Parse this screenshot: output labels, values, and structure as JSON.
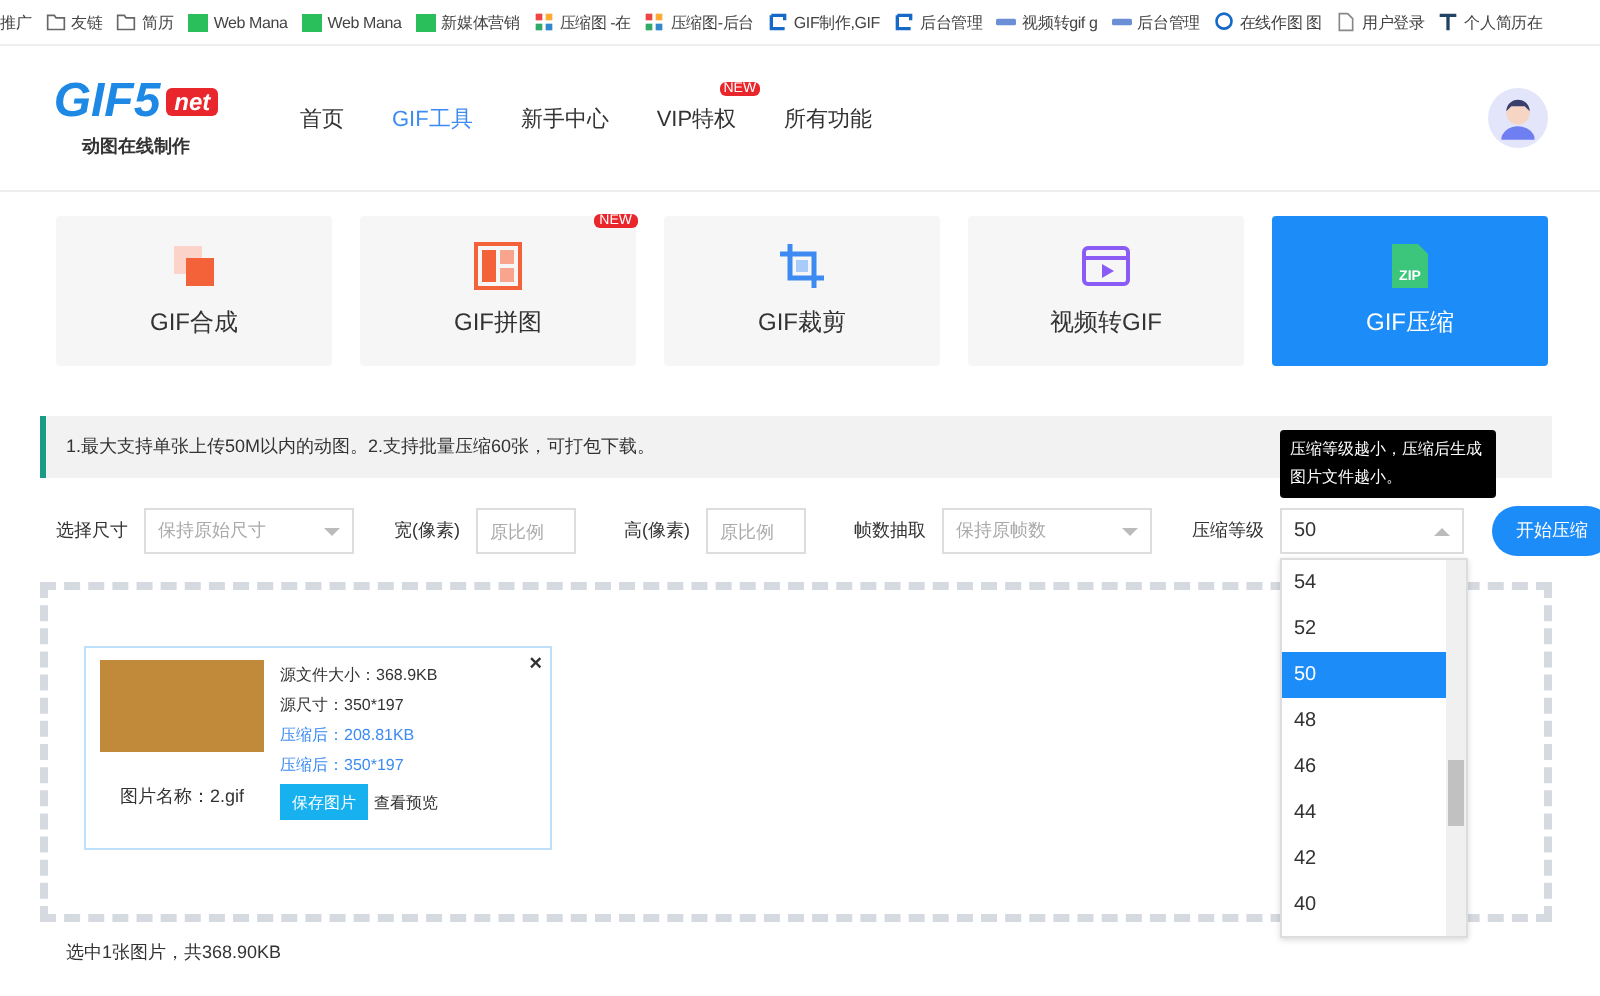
{
  "bookmarks": [
    {
      "label": "推广",
      "kind": "plain"
    },
    {
      "label": "友链",
      "kind": "folder"
    },
    {
      "label": "简历",
      "kind": "folder"
    },
    {
      "label": "Web Mana",
      "kind": "badge96"
    },
    {
      "label": "Web Mana",
      "kind": "badge96"
    },
    {
      "label": "新媒体营销",
      "kind": "badge96"
    },
    {
      "label": "压缩图 -在",
      "kind": "cross"
    },
    {
      "label": "压缩图-后台",
      "kind": "cross"
    },
    {
      "label": "GIF制作,GIF",
      "kind": "bracket"
    },
    {
      "label": "后台管理",
      "kind": "bracket"
    },
    {
      "label": "视频转gif g",
      "kind": "gif"
    },
    {
      "label": "后台管理",
      "kind": "gif"
    },
    {
      "label": "在线作图 图",
      "kind": "bubble"
    },
    {
      "label": "用户登录",
      "kind": "page"
    },
    {
      "label": "个人简历在",
      "kind": "tool"
    }
  ],
  "logo": {
    "name": "GIF5",
    "badge": "net",
    "tagline": "动图在线制作"
  },
  "nav": [
    {
      "label": "首页",
      "selected": false
    },
    {
      "label": "GIF工具",
      "selected": true
    },
    {
      "label": "新手中心",
      "selected": false
    },
    {
      "label": "VIP特权",
      "selected": false,
      "badge": "NEW"
    },
    {
      "label": "所有功能",
      "selected": false
    }
  ],
  "tools": [
    {
      "label": "GIF合成",
      "kind": "merge",
      "selected": false
    },
    {
      "label": "GIF拼图",
      "kind": "grid",
      "selected": false,
      "badge": "NEW"
    },
    {
      "label": "GIF裁剪",
      "kind": "crop",
      "selected": false
    },
    {
      "label": "视频转GIF",
      "kind": "video",
      "selected": false
    },
    {
      "label": "GIF压缩",
      "kind": "zip",
      "selected": true,
      "icon_text": "ZIP"
    }
  ],
  "notice": "1.最大支持单张上传50M以内的动图。2.支持批量压缩60张，可打包下载。",
  "tooltip": "压缩等级越小，压缩后生成图片文件越小。",
  "controls": [
    {
      "label": "选择尺寸",
      "kind": "select",
      "placeholder": "保持原始尺寸"
    },
    {
      "label": "宽(像素)",
      "kind": "input",
      "placeholder": "原比例"
    },
    {
      "label": "高(像素)",
      "kind": "input",
      "placeholder": "原比例"
    },
    {
      "label": "帧数抽取",
      "kind": "select",
      "placeholder": "保持原帧数"
    },
    {
      "label": "压缩等级",
      "kind": "level",
      "value": "50",
      "expanded": true
    }
  ],
  "start_button": "开始压缩",
  "level_options": [
    {
      "label": "54",
      "selected": false
    },
    {
      "label": "52",
      "selected": false
    },
    {
      "label": "50",
      "selected": true
    },
    {
      "label": "48",
      "selected": false
    },
    {
      "label": "46",
      "selected": false
    },
    {
      "label": "44",
      "selected": false
    },
    {
      "label": "42",
      "selected": false
    },
    {
      "label": "40",
      "selected": false
    }
  ],
  "file_card": {
    "lines": [
      {
        "text": "源文件大小：368.9KB",
        "kind": "source"
      },
      {
        "text": "源尺寸：350*197",
        "kind": "source"
      },
      {
        "text": "压缩后：208.81KB",
        "kind": "result"
      },
      {
        "text": "压缩后：350*197",
        "kind": "result"
      }
    ],
    "name": "图片名称：2.gif",
    "save": "保存图片",
    "preview": "查看预览",
    "close": "×"
  },
  "summary": "选中1张图片，共368.90KB"
}
